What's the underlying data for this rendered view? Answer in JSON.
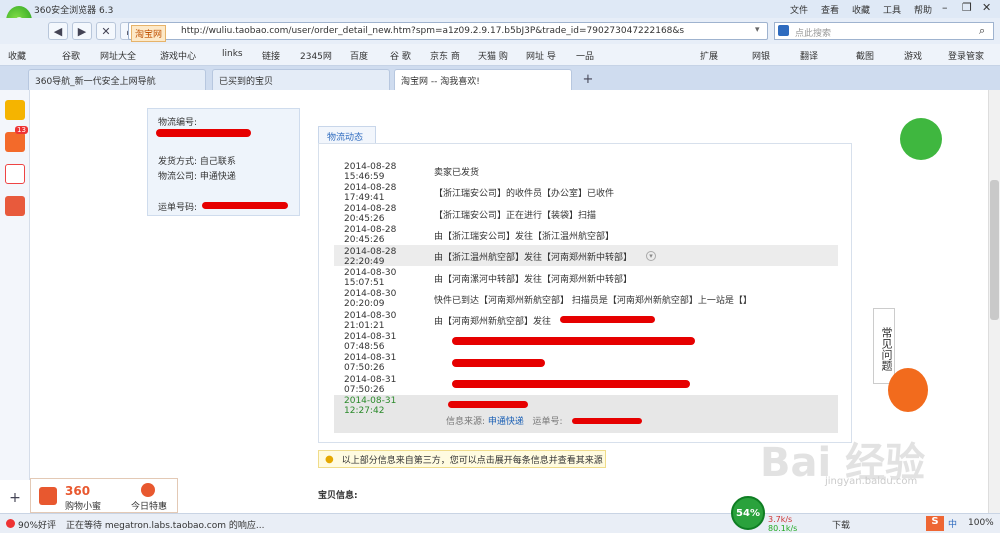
{
  "window": {
    "title": "360安全浏览器 6.3",
    "menus": [
      "文件",
      "查看",
      "收藏",
      "工具",
      "帮助"
    ]
  },
  "nav": {
    "url": "http://wuliu.taobao.com/user/order_detail_new.htm?spm=a1z09.2.9.17.b5bJ3P&trade_id=790273047222168&s",
    "site_badge": "淘宝网",
    "search_placeholder": "点此搜索"
  },
  "favorites": [
    "收藏",
    "谷歌",
    "网址大全",
    "游戏中心",
    "links",
    "链接",
    "2345网",
    "百度",
    "谷 歌",
    "京东 商",
    "天猫 购",
    "网址 导",
    "一品"
  ],
  "favorites_right": [
    "扩展",
    "网银",
    "翻译",
    "截图",
    "游戏",
    "登录管家"
  ],
  "tabs": [
    "360导航_新一代安全上网导航",
    "已买到的宝贝",
    "淘宝网 -- 淘我喜欢!"
  ],
  "sidebar": {
    "badge": "13"
  },
  "left_panel": {
    "tracking_label": "物流编号:",
    "ship_method": "发货方式: 自己联系",
    "company": "物流公司: 申通快递",
    "waybill": "运单号码:"
  },
  "logistics": {
    "tab": "物流动态",
    "rows": [
      {
        "time": "2014-08-28 15:46:59",
        "desc": "卖家已发货"
      },
      {
        "time": "2014-08-28 17:49:41",
        "desc": "【浙江瑞安公司】的收件员【办公室】已收件"
      },
      {
        "time": "2014-08-28 20:45:26",
        "desc": "【浙江瑞安公司】正在进行【装袋】扫描"
      },
      {
        "time": "2014-08-28 20:45:26",
        "desc": "由【浙江瑞安公司】发往【浙江温州航空部】"
      },
      {
        "time": "2014-08-28 22:20:49",
        "desc": "由【浙江温州航空部】发往【河南郑州新中转部】"
      },
      {
        "time": "2014-08-30 15:07:51",
        "desc": "由【河南漯河中转部】发往【河南郑州新中转部】"
      },
      {
        "time": "2014-08-30 20:20:09",
        "desc": "快件已到达【河南郑州新航空部】 扫描员是【河南郑州新航空部】上一站是【】"
      },
      {
        "time": "2014-08-30 21:01:21",
        "desc": "由【河南郑州新航空部】发往"
      },
      {
        "time": "2014-08-31 07:48:56",
        "desc": ""
      },
      {
        "time": "2014-08-31 07:50:26",
        "desc": ""
      },
      {
        "time": "2014-08-31 07:50:26",
        "desc": ""
      },
      {
        "time": "2014-08-31 12:27:42",
        "desc": ""
      }
    ],
    "source_label": "信息来源:",
    "source_value": "申通快递",
    "waybill_label": "运单号:",
    "notice": "以上部分信息来自第三方，您可以点击展开每条信息并查看其来源",
    "section": "宝贝信息:"
  },
  "right": {
    "faq": "常见问题"
  },
  "bottom_panel": {
    "item1": "购物小蜜",
    "item2": "今日特惠"
  },
  "watermark": {
    "text": "Bai 经验",
    "url": "jingyan.baidu.com"
  },
  "status": {
    "rating": "90%好评",
    "message": "正在等待 megatron.labs.taobao.com 的响应...",
    "progress": "54%",
    "up": "3.7k/s",
    "down": "80.1k/s",
    "download": "下载",
    "zoom": "100%",
    "ime": "中"
  },
  "colors": {
    "accent": "#2e6bbf",
    "time_green": "#2b8a2b",
    "link": "#1a5fb4"
  }
}
